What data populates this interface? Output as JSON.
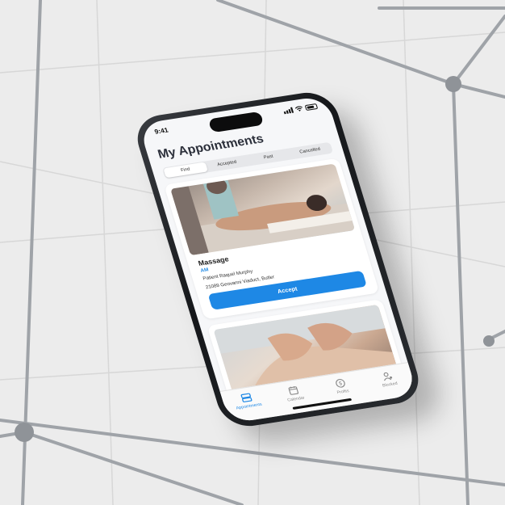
{
  "status_bar": {
    "time": "9:41"
  },
  "header": {
    "title": "My Appointments"
  },
  "segments": [
    {
      "label": "Find",
      "active": true
    },
    {
      "label": "Accepted",
      "active": false
    },
    {
      "label": "Past",
      "active": false
    },
    {
      "label": "Cancelled",
      "active": false
    }
  ],
  "cards": [
    {
      "service": "Massage",
      "time_of_day": "AM",
      "patient": "Patient Raquel Murphy",
      "address": "21089 Geovanni Viaduct, Butler",
      "action_label": "Accept"
    }
  ],
  "tabbar": [
    {
      "label": "Appointments",
      "icon": "appointments-icon",
      "active": true
    },
    {
      "label": "Calendar",
      "icon": "calendar-icon",
      "active": false
    },
    {
      "label": "Profits",
      "icon": "dollar-icon",
      "active": false
    },
    {
      "label": "Blocked",
      "icon": "blocked-user-icon",
      "active": false
    }
  ],
  "colors": {
    "accent": "#1e88e5",
    "background": "#ececec",
    "phone_frame": "#2a2d31"
  }
}
